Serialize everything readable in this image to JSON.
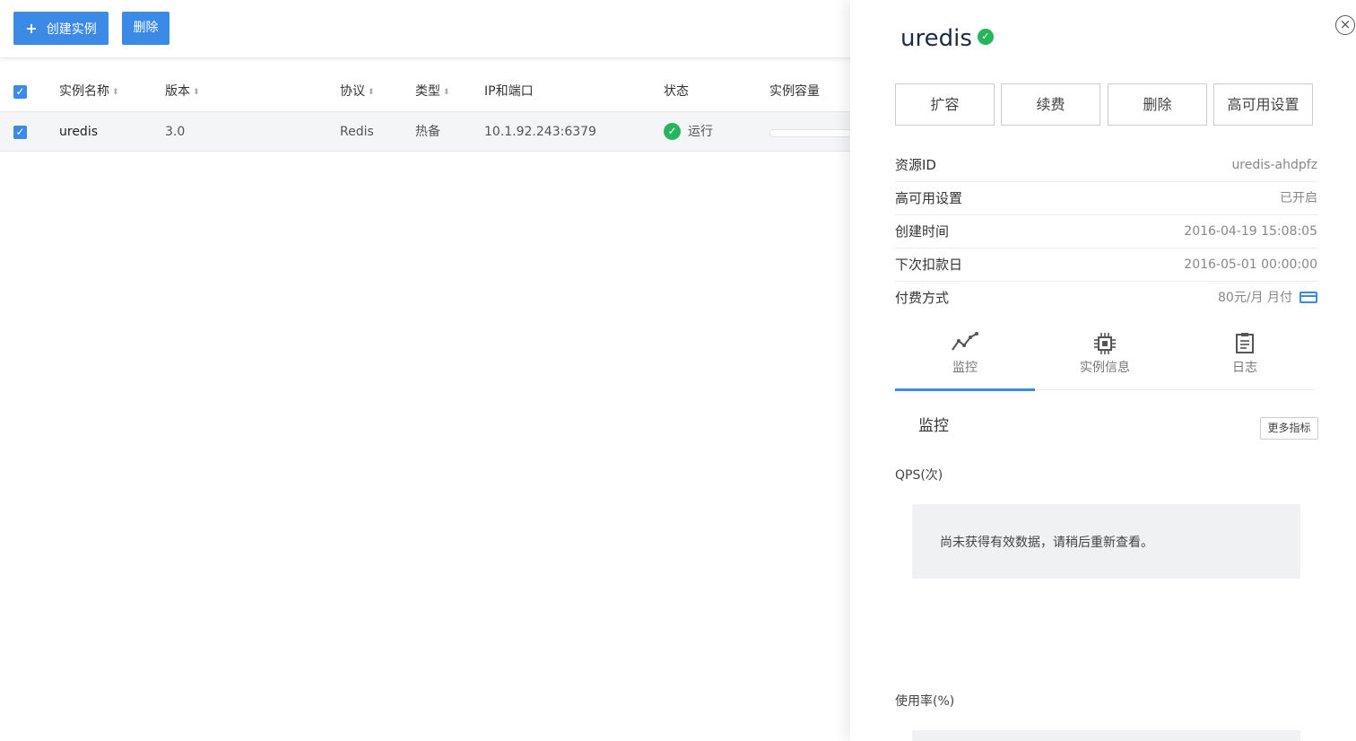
{
  "toolbar": {
    "create_label": "创建实例",
    "create_icon": "+",
    "delete_label": "删除"
  },
  "table": {
    "headers": {
      "name": "实例名称",
      "version": "版本",
      "protocol": "协议",
      "type": "类型",
      "ip_port": "IP和端口",
      "status": "状态",
      "capacity": "实例容量"
    },
    "rows": [
      {
        "name": "uredis",
        "version": "3.0",
        "protocol": "Redis",
        "type": "热备",
        "ip_port": "10.1.92.243:6379",
        "status": "运行",
        "checked": true
      }
    ]
  },
  "panel": {
    "title": "uredis",
    "actions": [
      "扩容",
      "续费",
      "删除",
      "高可用设置"
    ],
    "info": [
      {
        "key": "资源ID",
        "value": "uredis-ahdpfz"
      },
      {
        "key": "高可用设置",
        "value": "已开启"
      },
      {
        "key": "创建时间",
        "value": "2016-04-19 15:08:05"
      },
      {
        "key": "下次扣款日",
        "value": "2016-05-01 00:00:00"
      },
      {
        "key": "付费方式",
        "value": "80元/月 月付"
      }
    ],
    "tabs": [
      {
        "label": "监控",
        "icon": "line-chart-icon",
        "active": true
      },
      {
        "label": "实例信息",
        "icon": "chip-icon",
        "active": false
      },
      {
        "label": "日志",
        "icon": "clipboard-icon",
        "active": false
      }
    ],
    "monitor": {
      "title": "监控",
      "more_label": "更多指标",
      "qps_label": "QPS(次)",
      "empty_text": "尚未获得有效数据，请稍后重新查看。",
      "usage_label": "使用率(%)"
    }
  },
  "colors": {
    "primary": "#3b8ae6",
    "success": "#27b55b"
  }
}
